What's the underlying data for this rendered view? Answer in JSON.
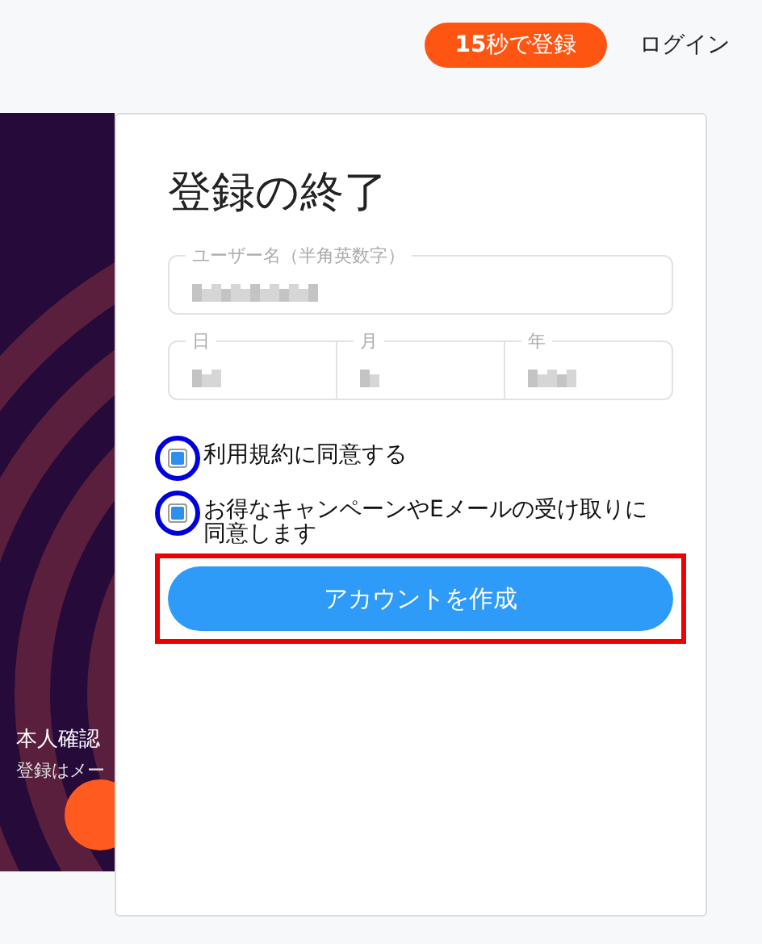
{
  "header": {
    "signup_button": "**15**秒で登録",
    "login_link": "ログイン"
  },
  "side_panel": {
    "kind": "picture",
    "heading": "本人確認",
    "subtext": "登録はメー"
  },
  "form": {
    "title": "登録の終了",
    "username": {
      "label": "ユーザー名（半角英数字）"
    },
    "birth_date": [
      {
        "label": "日"
      },
      {
        "label": "月"
      },
      {
        "label": "年"
      }
    ],
    "checkboxes": [
      {
        "label": "利用規約に同意する",
        "checked": true,
        "highlighted": true
      },
      {
        "label": "お得なキャンペーンやEメールの受け取りに同意します",
        "checked": true,
        "highlighted": true
      }
    ],
    "submit": {
      "label": "アカウントを作成",
      "highlighted": true
    }
  }
}
